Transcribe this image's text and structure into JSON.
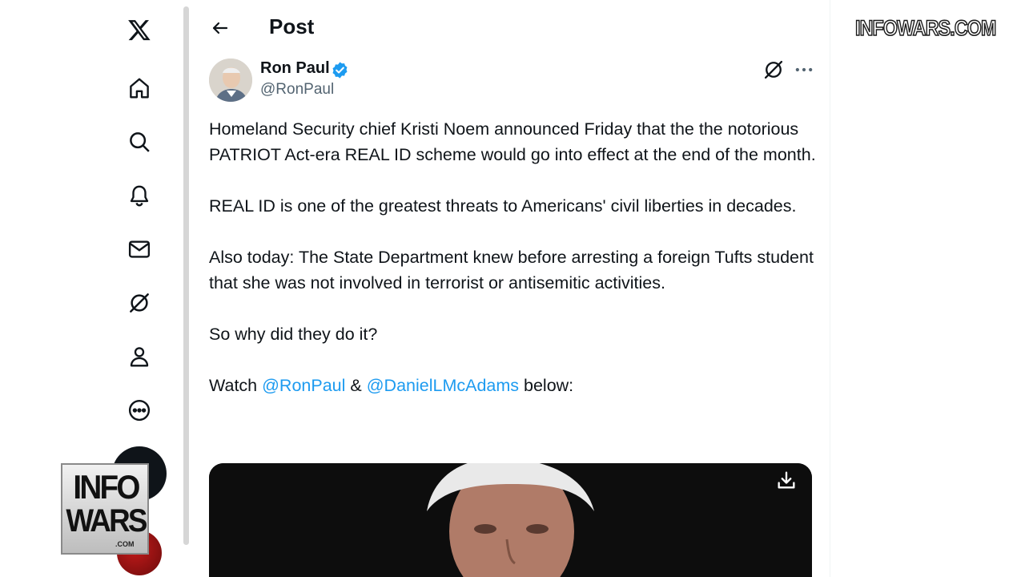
{
  "nav": {
    "items": [
      {
        "name": "x-logo-icon"
      },
      {
        "name": "home-icon"
      },
      {
        "name": "search-icon"
      },
      {
        "name": "notifications-icon"
      },
      {
        "name": "messages-icon"
      },
      {
        "name": "grok-icon"
      },
      {
        "name": "profile-icon"
      },
      {
        "name": "more-icon"
      }
    ],
    "compose_icon": "compose-post-icon"
  },
  "header": {
    "title": "Post"
  },
  "post": {
    "author_name": "Ron Paul",
    "author_handle": "@RonPaul",
    "verified": true,
    "paragraphs": [
      "Homeland Security chief Kristi Noem announced Friday that the the notorious PATRIOT Act-era REAL ID scheme would go into effect at the end of the month.",
      "REAL ID is one of the greatest threats to Americans' civil liberties in decades.",
      "Also today: The State Department knew before arresting a foreign Tufts student that she was not involved in terrorist or antisemitic activities.",
      "So why did they do it?"
    ],
    "watch_line": {
      "prefix": "Watch ",
      "mention1": "@RonPaul",
      "amp": " & ",
      "mention2": "@DanielLMcAdams",
      "suffix": " below:"
    }
  },
  "watermark": {
    "top_right": "INFOWARS.COM",
    "logo_line1": "INFO",
    "logo_line2": "WARS",
    "logo_line3": ".COM"
  },
  "colors": {
    "accent": "#1d9bf0",
    "text": "#0f1419",
    "muted": "#536471"
  }
}
